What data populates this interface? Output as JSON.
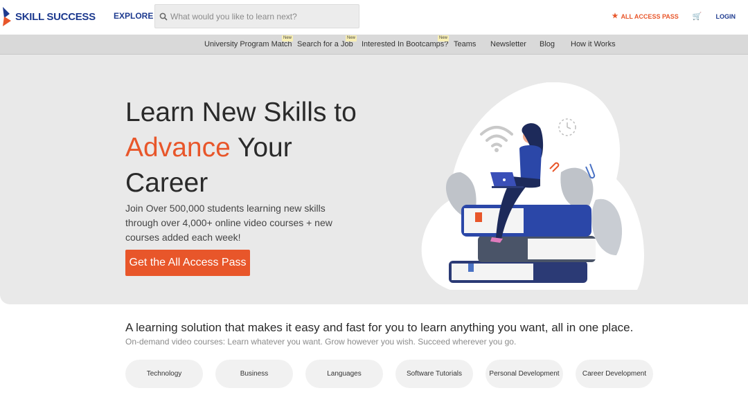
{
  "brand": {
    "name": "SKILL SUCCESS",
    "accent_color": "#e8562a",
    "brand_color": "#1d3a8f"
  },
  "header": {
    "explore_label": "EXPLORE",
    "search_placeholder": "What would you like to learn next?",
    "all_access_label": "ALL ACCESS PASS",
    "cart_icon": "cart-icon",
    "login_label": "LOGIN"
  },
  "nav": {
    "items": [
      {
        "label": "University Program Match",
        "badge": "New"
      },
      {
        "label": "Search for a Job",
        "badge": "New"
      },
      {
        "label": "Interested In Bootcamps?",
        "badge": "New"
      },
      {
        "label": "Teams"
      },
      {
        "label": "Newsletter"
      },
      {
        "label": "Blog"
      },
      {
        "label": "How it Works"
      }
    ]
  },
  "hero": {
    "title_line1": "Learn New Skills to",
    "title_accent": "Advance",
    "title_line2_rest": " Your",
    "title_line3": "Career",
    "subtitle": "Join Over 500,000 students learning new skills through over 4,000+ online video courses + new courses added each week!",
    "cta_label": "Get the All Access Pass"
  },
  "section": {
    "title": "A learning solution that makes it easy and fast for you to learn anything you want, all in one place.",
    "subtitle": "On-demand video courses: Learn whatever you want. Grow however you wish. Succeed wherever you go.",
    "categories": [
      "Technology",
      "Business",
      "Languages",
      "Software Tutorials",
      "Personal Development",
      "Career Development"
    ]
  }
}
